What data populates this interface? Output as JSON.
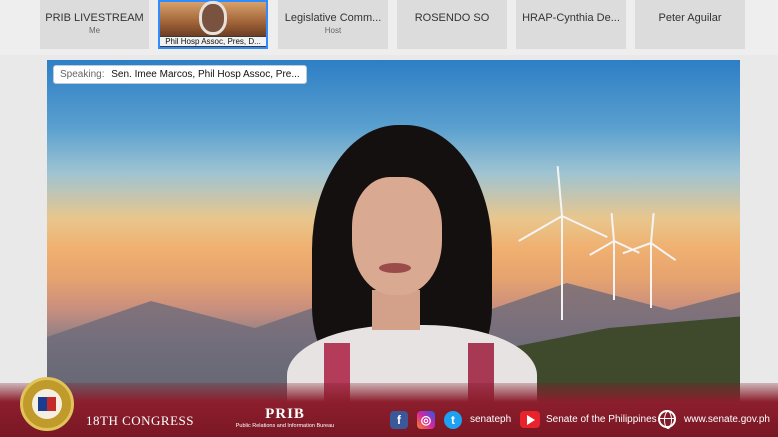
{
  "participants": [
    {
      "name": "PRIB LIVESTREAM",
      "sub": "Me"
    },
    {
      "name": "Phil Hosp Assoc, Pres, D...",
      "sub": ""
    },
    {
      "name": "Legislative Comm...",
      "sub": "Host"
    },
    {
      "name": "ROSENDO SO",
      "sub": ""
    },
    {
      "name": "HRAP-Cynthia De...",
      "sub": ""
    },
    {
      "name": "Peter Aguilar",
      "sub": ""
    }
  ],
  "speaking": {
    "label": "Speaking:",
    "names": "Sen. Imee Marcos,   Phil Hosp Assoc, Pre..."
  },
  "footer": {
    "congress": "18TH CONGRESS",
    "prib_title": "PRIB",
    "prib_sub": "Public Relations and Information Bureau",
    "social_handle": "senateph",
    "youtube_label": "Senate of the Philippines",
    "website": "www.senate.gov.ph"
  },
  "colors": {
    "accent": "#2d8cff",
    "banner": "#8c1e2d",
    "facebook": "#3b5998",
    "instagram": "#d6249f",
    "twitter": "#1da1f2",
    "youtube": "#e8232b"
  }
}
